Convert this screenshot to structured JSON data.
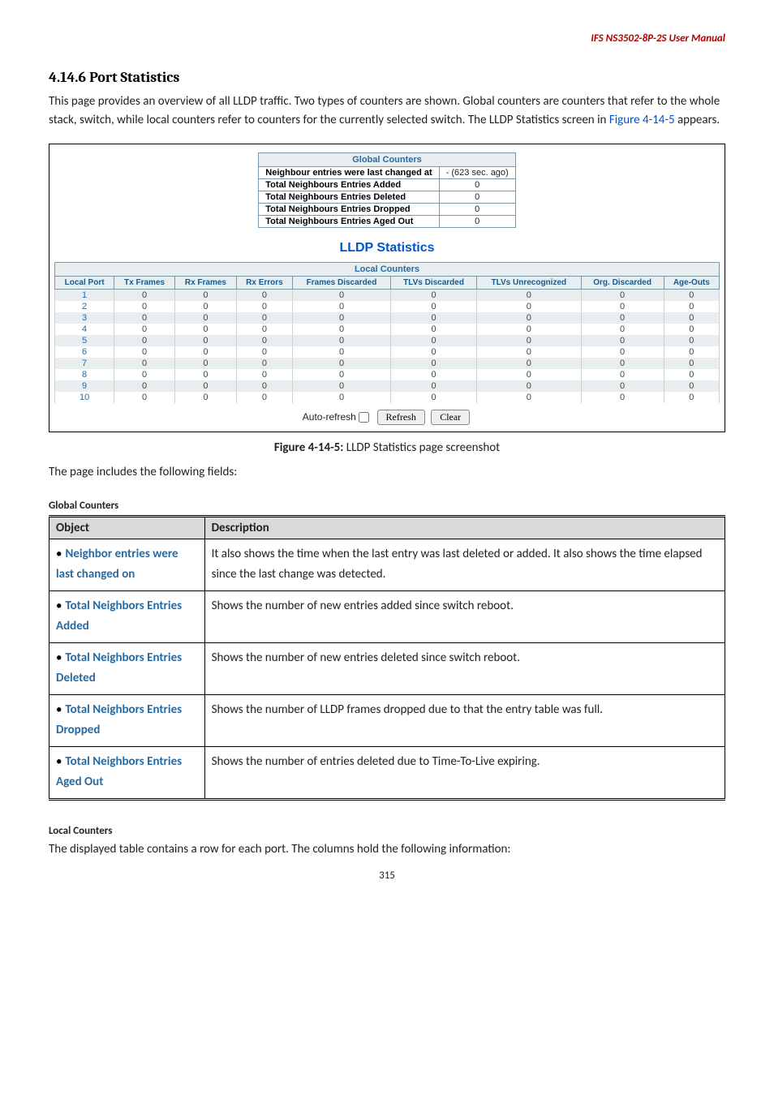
{
  "header": {
    "manual_title": "IFS NS3502-8P-2S  User Manual"
  },
  "section": {
    "number_title": "4.14.6 Port Statistics",
    "intro_part1": "This page provides an overview of all LLDP traffic. Two types of counters are shown. Global counters are counters that refer to the whole stack, switch, while local counters refer to counters for the currently selected switch. The LLDP Statistics screen in ",
    "figure_link": "Figure 4-14-5",
    "intro_part2": " appears."
  },
  "global_counters": {
    "header": "Global Counters",
    "row1_label": "Neighbour entries were last changed at",
    "row1_val": " - (623 sec. ago)",
    "row2_label": "Total Neighbours Entries Added",
    "row2_val": "0",
    "row3_label": "Total Neighbours Entries Deleted",
    "row3_val": "0",
    "row4_label": "Total Neighbours Entries Dropped",
    "row4_val": "0",
    "row5_label": "Total Neighbours Entries Aged Out",
    "row5_val": "0"
  },
  "stats_title": "LLDP Statistics",
  "local_counters": {
    "header": "Local Counters",
    "cols": {
      "c0": "Local Port",
      "c1": "Tx Frames",
      "c2": "Rx Frames",
      "c3": "Rx Errors",
      "c4": "Frames Discarded",
      "c5": "TLVs Discarded",
      "c6": "TLVs Unrecognized",
      "c7": "Org. Discarded",
      "c8": "Age-Outs"
    },
    "rows": [
      {
        "port": "1",
        "tx": "0",
        "rx": "0",
        "rxe": "0",
        "fd": "0",
        "td": "0",
        "tu": "0",
        "od": "0",
        "ao": "0"
      },
      {
        "port": "2",
        "tx": "0",
        "rx": "0",
        "rxe": "0",
        "fd": "0",
        "td": "0",
        "tu": "0",
        "od": "0",
        "ao": "0"
      },
      {
        "port": "3",
        "tx": "0",
        "rx": "0",
        "rxe": "0",
        "fd": "0",
        "td": "0",
        "tu": "0",
        "od": "0",
        "ao": "0"
      },
      {
        "port": "4",
        "tx": "0",
        "rx": "0",
        "rxe": "0",
        "fd": "0",
        "td": "0",
        "tu": "0",
        "od": "0",
        "ao": "0"
      },
      {
        "port": "5",
        "tx": "0",
        "rx": "0",
        "rxe": "0",
        "fd": "0",
        "td": "0",
        "tu": "0",
        "od": "0",
        "ao": "0"
      },
      {
        "port": "6",
        "tx": "0",
        "rx": "0",
        "rxe": "0",
        "fd": "0",
        "td": "0",
        "tu": "0",
        "od": "0",
        "ao": "0"
      },
      {
        "port": "7",
        "tx": "0",
        "rx": "0",
        "rxe": "0",
        "fd": "0",
        "td": "0",
        "tu": "0",
        "od": "0",
        "ao": "0"
      },
      {
        "port": "8",
        "tx": "0",
        "rx": "0",
        "rxe": "0",
        "fd": "0",
        "td": "0",
        "tu": "0",
        "od": "0",
        "ao": "0"
      },
      {
        "port": "9",
        "tx": "0",
        "rx": "0",
        "rxe": "0",
        "fd": "0",
        "td": "0",
        "tu": "0",
        "od": "0",
        "ao": "0"
      },
      {
        "port": "10",
        "tx": "0",
        "rx": "0",
        "rxe": "0",
        "fd": "0",
        "td": "0",
        "tu": "0",
        "od": "0",
        "ao": "0"
      }
    ]
  },
  "controls": {
    "auto_refresh": "Auto-refresh",
    "refresh": "Refresh",
    "clear": "Clear"
  },
  "figure_caption": {
    "num": "Figure 4-14-5:",
    "text": " LLDP Statistics page screenshot"
  },
  "fields_intro": "The page includes the following fields:",
  "global_section_title": "Global Counters",
  "fields_table": {
    "hdr_obj": "Object",
    "hdr_desc": "Description",
    "r1_obj": "Neighbor entries were last changed on",
    "r1_desc": "It also shows the time when the last entry was last deleted or added. It also shows the time elapsed since the last change was detected.",
    "r2_obj": "Total Neighbors Entries Added",
    "r2_desc": "Shows the number of new entries added since switch reboot.",
    "r3_obj": "Total Neighbors Entries Deleted",
    "r3_desc": "Shows the number of new entries deleted since switch reboot.",
    "r4_obj": "Total Neighbors Entries Dropped",
    "r4_desc": "Shows the number of LLDP frames dropped due to that the entry table was full.",
    "r5_obj": "Total Neighbors Entries Aged Out",
    "r5_desc": "Shows the number of entries deleted due to Time-To-Live expiring."
  },
  "local_section_title": "Local Counters",
  "local_intro": "The displayed table contains a row for each port. The columns hold the following information:",
  "page_number": "315"
}
